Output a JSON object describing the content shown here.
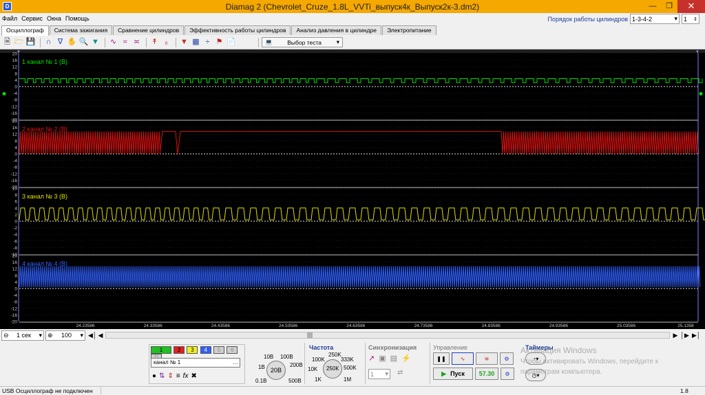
{
  "window": {
    "title": "Diamag 2 (Chevrolet_Cruze_1.8L_VVTi_выпуск4к_Выпуск2к-3.dm2)"
  },
  "menu": [
    "Файл",
    "Сервис",
    "Окна",
    "Помощь"
  ],
  "cylinder_order": {
    "label": "Порядок работы цилиндров",
    "value": "1-3-4-2",
    "stepper": "1"
  },
  "tabs": [
    "Осциллограф",
    "Система зажигания",
    "Сравнение цилиндров",
    "Эффективность работы цилиндров",
    "Анализ давления в цилиндре",
    "Электропитание"
  ],
  "toolbar": {
    "test_select": "Выбор теста"
  },
  "channels": [
    {
      "label": "1  канал № 1 (В)",
      "color": "#00e000",
      "ticks": [
        "20",
        "16",
        "12",
        "8",
        "4",
        "0",
        "-4",
        "-8",
        "-12",
        "-16",
        "-20"
      ]
    },
    {
      "label": "2  канал № 2 (В)",
      "color": "#e01010",
      "ticks": [
        "20",
        "16",
        "12",
        "8",
        "4",
        "0",
        "-4",
        "-8",
        "-12",
        "-16",
        "-20"
      ]
    },
    {
      "label": "3  канал № 3 (В)",
      "color": "#e0e000",
      "ticks": [
        "10",
        "8",
        "6",
        "4",
        "2",
        "0",
        "-2",
        "-4",
        "-6",
        "-8",
        "-10"
      ]
    },
    {
      "label": "4  канал № 4 (В)",
      "color": "#3060ff",
      "ticks": [
        "20",
        "16",
        "12",
        "8",
        "4",
        "0",
        "-4",
        "-8",
        "-12",
        "-16",
        "-20"
      ]
    }
  ],
  "time_ticks": [
    "24.23586",
    "24.33586",
    "24.43586",
    "24.53586",
    "24.63586",
    "24.73586",
    "24.83586",
    "24.93586",
    "25.03586",
    "25.1358"
  ],
  "timebase": {
    "value": "1 сек",
    "zoom": "100"
  },
  "channel_buttons": [
    "1",
    "2",
    "3",
    "4",
    "5",
    "6",
    "D"
  ],
  "channel_name": "канал № 1",
  "voltage": {
    "value": "20В",
    "labels": [
      "10В",
      "100В",
      "1В",
      "200В",
      "0.1В",
      "500В"
    ]
  },
  "frequency": {
    "title": "Частота",
    "value": "250К",
    "labels": [
      "250K",
      "100K",
      "333K",
      "10K",
      "500K",
      "1K",
      "1M"
    ]
  },
  "sync": {
    "title": "Синхронизация",
    "value": "1"
  },
  "control": {
    "title": "Управление",
    "start": "Пуск",
    "rate": "57.30"
  },
  "timers": {
    "title": "Таймеры"
  },
  "status": {
    "text": "USB Осциллограф не подключен",
    "version": "1.8"
  },
  "watermark": {
    "line1": "Активация Windows",
    "line2": "Чтобы активировать Windows, перейдите к",
    "line3": "параметрам компьютера."
  }
}
